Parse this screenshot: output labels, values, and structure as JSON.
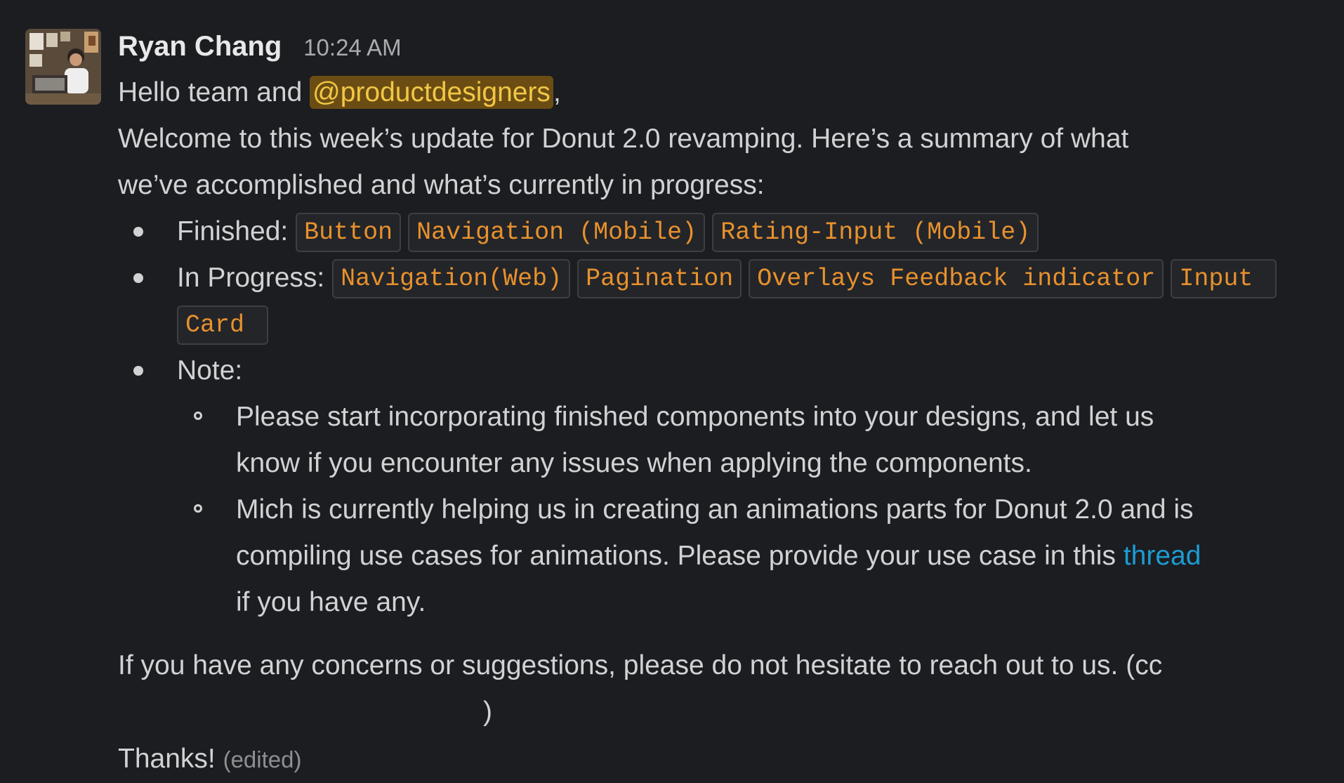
{
  "message": {
    "sender": "Ryan Chang",
    "timestamp": "10:24 AM",
    "greeting_prefix": "Hello team and ",
    "mention": "@productdesigners",
    "greeting_suffix": ",",
    "intro_line1": "Welcome to this week’s update for Donut 2.0 revamping. Here’s a summary of what",
    "intro_line2": "we’ve accomplished and what’s currently in progress:",
    "finished_label": "Finished:",
    "finished_items": [
      "Button",
      "Navigation (Mobile)",
      "Rating-Input (Mobile)"
    ],
    "in_progress_label": "In Progress:",
    "in_progress_items": [
      "Navigation(Web)",
      "Pagination",
      "Overlays Feedback indicator",
      "Input",
      "Card"
    ],
    "note_label": "Note:",
    "note1_line1": "Please start incorporating finished components into your designs, and let us",
    "note1_line2": "know if you encounter any issues when applying the components.",
    "note2_line1": "Mich is currently helping us in creating an animations parts for Donut 2.0 and is",
    "note2_line2_prefix": "compiling use cases for animations. Please provide your use case in this ",
    "note2_link": "thread",
    "note2_line3": "if you have any.",
    "closing_line1": "If you have any concerns or suggestions, please do not hesitate to reach out to us. (cc",
    "closing_line2": ")",
    "thanks": "Thanks!",
    "edited": "(edited)"
  },
  "colors": {
    "background": "#1b1d21",
    "text": "#d1d2d3",
    "mention_bg": "#6b4d14",
    "mention_text": "#f2c744",
    "code_text": "#e8912d",
    "link": "#1d9bd1"
  }
}
